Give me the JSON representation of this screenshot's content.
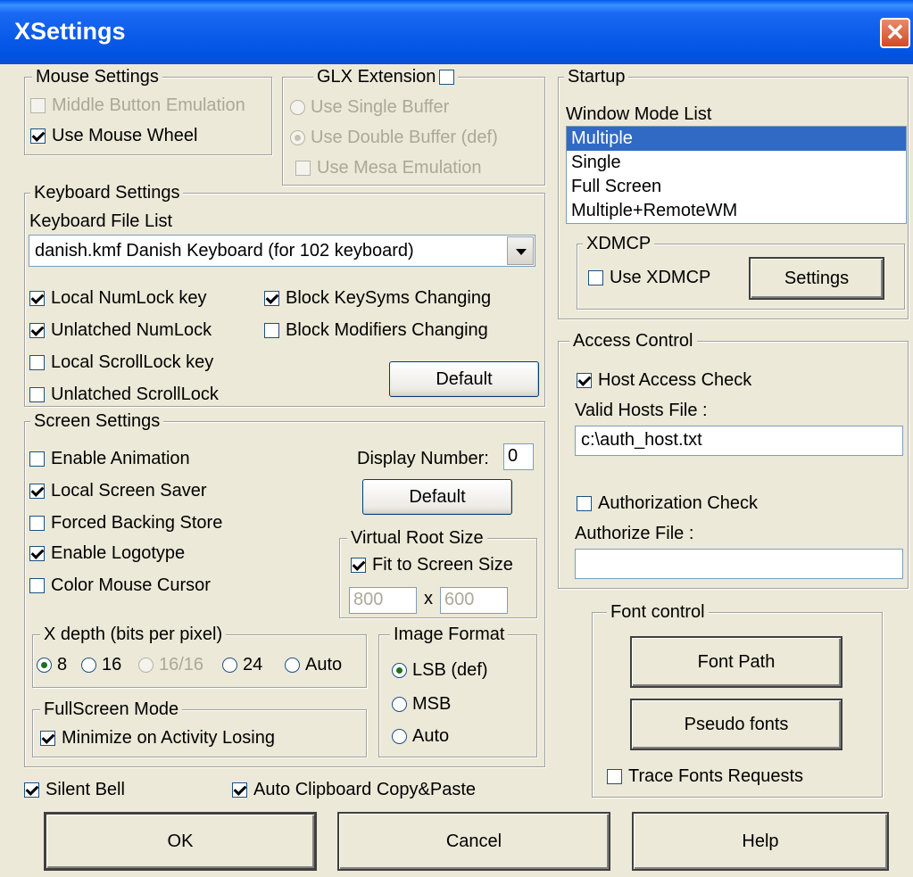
{
  "window": {
    "title": "XSettings",
    "close": "✕"
  },
  "mouse": {
    "title": "Mouse Settings",
    "middle_button_emulation": {
      "label": "Middle Button Emulation",
      "checked": false,
      "disabled": true
    },
    "use_mouse_wheel": {
      "label": "Use Mouse Wheel",
      "checked": true
    }
  },
  "glx": {
    "title": "GLX Extension",
    "enabled": false,
    "single_buffer": "Use Single Buffer",
    "double_buffer": "Use Double Buffer (def)",
    "mesa_emulation": "Use Mesa Emulation"
  },
  "keyboard": {
    "title": "Keyboard Settings",
    "file_list_label": "Keyboard File List",
    "selected_file": "danish.kmf   Danish Keyboard (for 102 keyboard)",
    "local_numlock": "Local NumLock key",
    "unlatched_numlock": "Unlatched NumLock",
    "local_scrolllock": "Local ScrollLock key",
    "unlatched_scrolllock": "Unlatched ScrollLock",
    "block_keysyms": "Block KeySyms Changing",
    "block_modifiers": "Block Modifiers Changing",
    "default_btn": "Default"
  },
  "screen": {
    "title": "Screen Settings",
    "enable_animation": "Enable Animation",
    "local_screen_saver": "Local Screen Saver",
    "forced_backing_store": "Forced Backing Store",
    "enable_logotype": "Enable Logotype",
    "color_mouse_cursor": "Color Mouse Cursor",
    "display_number_label": "Display Number:",
    "display_number": "0",
    "default_btn": "Default",
    "virtual_root": {
      "title": "Virtual Root Size",
      "fit_to_screen": "Fit to Screen Size",
      "width": "800",
      "x_sep": "x",
      "height": "600"
    },
    "xdepth": {
      "title": "X depth (bits per pixel)",
      "opt8": "8",
      "opt16": "16",
      "opt1616": "16/16",
      "opt24": "24",
      "optauto": "Auto"
    },
    "image_format": {
      "title": "Image Format",
      "lsb": "LSB (def)",
      "msb": "MSB",
      "auto": "Auto"
    },
    "fullscreen": {
      "title": "FullScreen Mode",
      "minimize": "Minimize on Activity Losing"
    }
  },
  "bottom": {
    "silent_bell": "Silent Bell",
    "auto_clipboard": "Auto Clipboard Copy&Paste"
  },
  "startup": {
    "title": "Startup",
    "window_mode_label": "Window Mode List",
    "modes": [
      "Multiple",
      "Single",
      "Full Screen",
      "Multiple+RemoteWM"
    ],
    "xdmcp": {
      "title": "XDMCP",
      "use_xdmcp": "Use XDMCP",
      "settings_btn": "Settings"
    }
  },
  "access": {
    "title": "Access Control",
    "host_access_check": "Host Access Check",
    "valid_hosts_label": "Valid Hosts File :",
    "valid_hosts_value": "c:\\auth_host.txt",
    "authorization_check": "Authorization Check",
    "authorize_file_label": "Authorize File :",
    "authorize_file_value": ""
  },
  "font": {
    "title": "Font control",
    "font_path_btn": "Font Path",
    "pseudo_fonts_btn": "Pseudo fonts",
    "trace_fonts": "Trace Fonts Requests"
  },
  "buttons": {
    "ok": "OK",
    "cancel": "Cancel",
    "help": "Help"
  }
}
